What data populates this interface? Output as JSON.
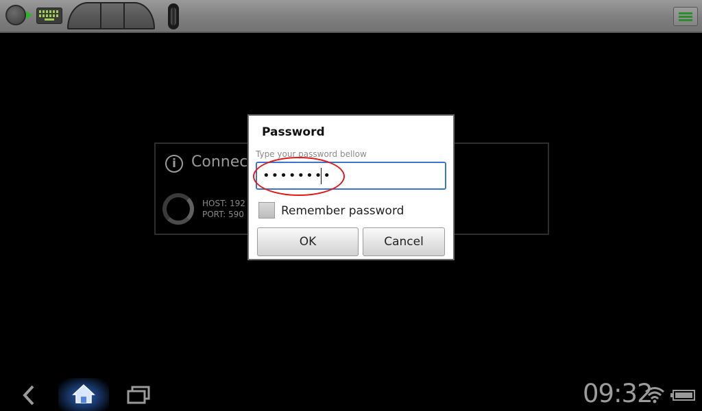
{
  "toolbar": {
    "icons": [
      "connection-icon",
      "keyboard-icon",
      "mouse-buttons-icon",
      "scroll-wheel-icon",
      "menu-icon"
    ]
  },
  "connecting_panel": {
    "title": "Connect",
    "host": "HOST: 192",
    "port": "PORT: 590"
  },
  "dialog": {
    "title": "Password",
    "hint": "Type your password bellow",
    "password_value": "••••••••",
    "remember_label": "Remember password",
    "ok_label": "OK",
    "cancel_label": "Cancel"
  },
  "status_bar": {
    "time": "09:32",
    "icons": [
      "back-icon",
      "home-icon",
      "recent-apps-icon",
      "wifi-icon",
      "battery-icon"
    ]
  },
  "colors": {
    "input_focus": "#3d73c9",
    "annotation": "#e01818",
    "toolbar_accent": "#2db52d"
  }
}
